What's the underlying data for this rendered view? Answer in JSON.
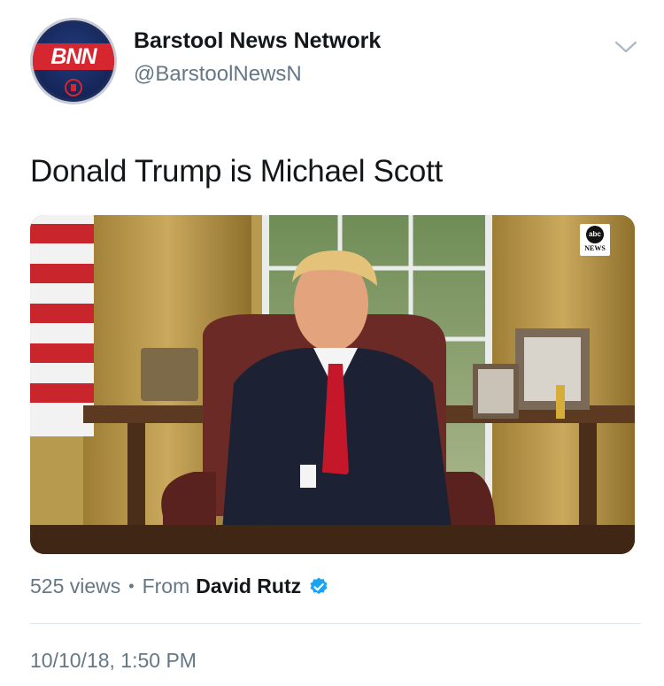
{
  "tweet": {
    "author": {
      "display_name": "Barstool News Network",
      "handle": "@BarstoolNewsN",
      "avatar_text": "BNN"
    },
    "text": "Donald Trump is Michael Scott",
    "media": {
      "type": "video",
      "watermark_text": "NEWS",
      "watermark_logo_text": "abc"
    },
    "meta": {
      "views": "525 views",
      "separator": "•",
      "from_label": "From",
      "source_author": "David Rutz"
    },
    "timestamp": "10/10/18, 1:50 PM"
  },
  "icons": {
    "menu": "chevron-down-icon",
    "verified": "verified-badge-icon"
  },
  "colors": {
    "name": "#14171a",
    "secondary": "#657786",
    "verified": "#1da1f2",
    "avatar_red": "#d6262f",
    "avatar_navy": "#1c2d5e"
  }
}
